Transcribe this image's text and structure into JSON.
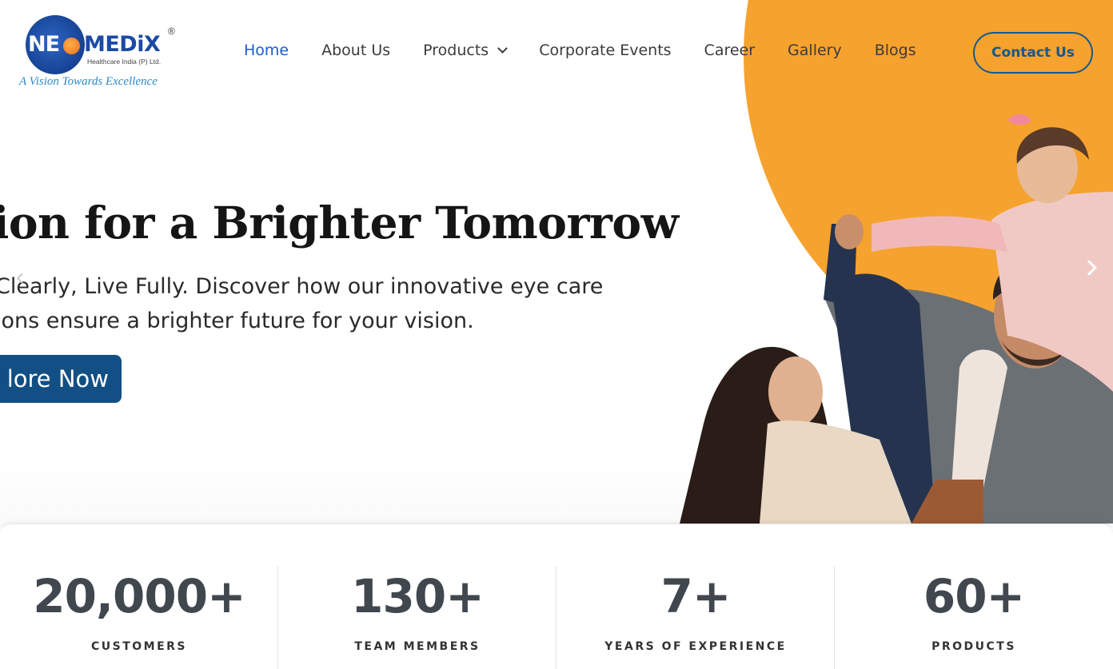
{
  "logo": {
    "brand": "NEOMEDiX",
    "brand_ne": "NE",
    "brand_medix": "MEDiX",
    "registered": "®",
    "company": "Healthcare India (P) Ltd.",
    "tagline": "A Vision Towards Excellence"
  },
  "nav": {
    "items": [
      {
        "label": "Home",
        "active": true
      },
      {
        "label": "About Us"
      },
      {
        "label": "Products",
        "has_dropdown": true
      },
      {
        "label": "Corporate Events"
      },
      {
        "label": "Career"
      },
      {
        "label": "Gallery"
      },
      {
        "label": "Blogs"
      }
    ],
    "contact_label": "Contact Us"
  },
  "hero": {
    "title": "sion for a Brighter Tomorrow",
    "subtitle_line1": "Clearly, Live Fully. Discover how our innovative eye care",
    "subtitle_line2": "ions ensure a brighter future for your vision.",
    "cta_label": "lore Now",
    "prev_icon": "chevron-left-icon",
    "next_icon": "chevron-right-icon"
  },
  "stats": [
    {
      "value": "20,000+",
      "label": "CUSTOMERS"
    },
    {
      "value": "130+",
      "label": "TEAM MEMBERS"
    },
    {
      "value": "7+",
      "label": "YEARS OF EXPERIENCE"
    },
    {
      "value": "60+",
      "label": "PRODUCTS"
    }
  ],
  "colors": {
    "accent_orange": "#f6a22f",
    "brand_blue": "#14598f",
    "nav_active": "#1e5bc6",
    "cta_bg": "#124f84",
    "stat_text": "#41474f"
  }
}
